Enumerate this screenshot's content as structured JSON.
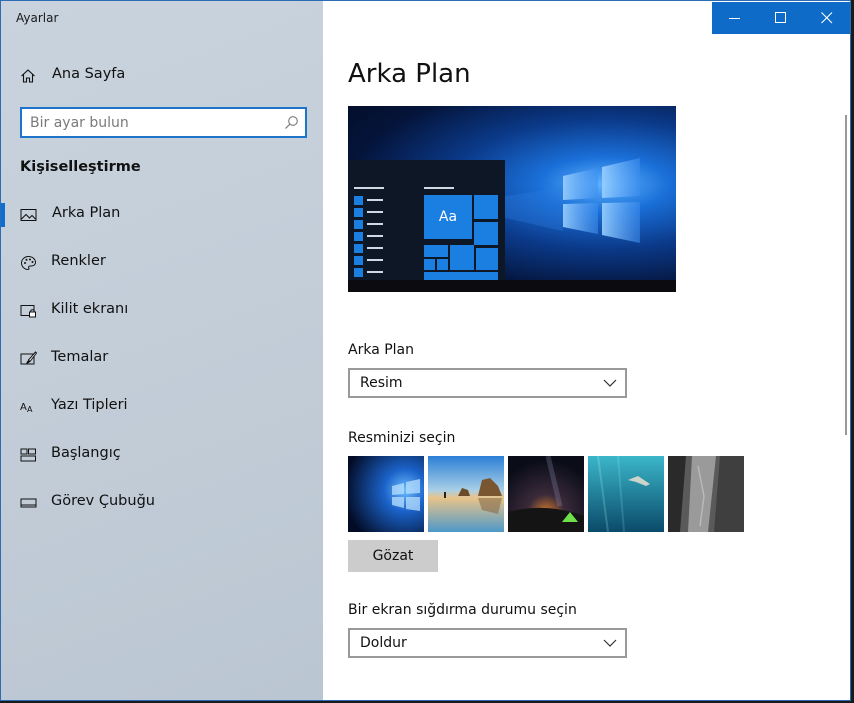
{
  "window": {
    "app_title": "Ayarlar"
  },
  "sidebar": {
    "home_label": "Ana Sayfa",
    "search_placeholder": "Bir ayar bulun",
    "section_title": "Kişiselleştirme",
    "items": [
      {
        "label": "Arka Plan",
        "icon": "picture-icon",
        "active": true
      },
      {
        "label": "Renkler",
        "icon": "palette-icon",
        "active": false
      },
      {
        "label": "Kilit ekranı",
        "icon": "lock-screen-icon",
        "active": false
      },
      {
        "label": "Temalar",
        "icon": "theme-brush-icon",
        "active": false
      },
      {
        "label": "Yazı Tipleri",
        "icon": "font-icon",
        "active": false
      },
      {
        "label": "Başlangıç",
        "icon": "start-tiles-icon",
        "active": false
      },
      {
        "label": "Görev Çubuğu",
        "icon": "taskbar-icon",
        "active": false
      }
    ]
  },
  "content": {
    "page_title": "Arka Plan",
    "preview_tile_text": "Aa",
    "background_label": "Arka Plan",
    "background_value": "Resim",
    "choose_picture_label": "Resminizi seçin",
    "browse_label": "Gözat",
    "fit_label": "Bir ekran sığdırma durumu seçin",
    "fit_value": "Doldur"
  },
  "colors": {
    "accent": "#0e6bc7",
    "sidebar_bg": "#c6d0db"
  }
}
